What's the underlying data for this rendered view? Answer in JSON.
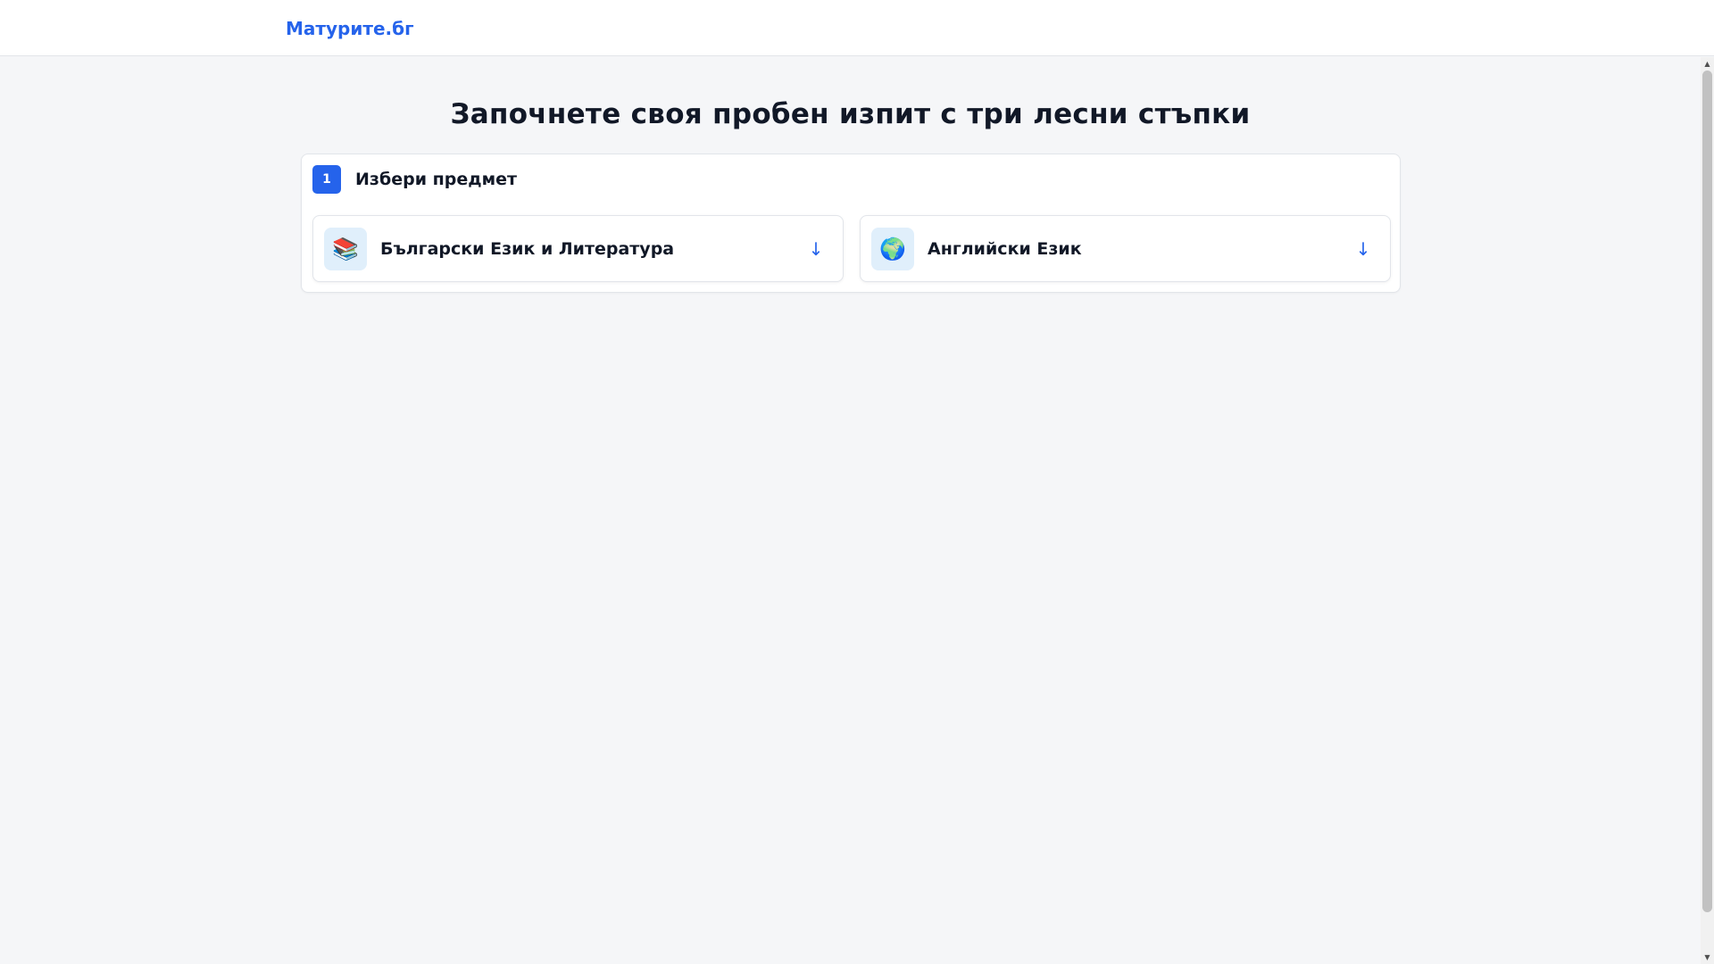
{
  "header": {
    "brand": "Матурите.бг"
  },
  "main": {
    "headline": "Започнете своя пробен изпит с три лесни стъпки",
    "step": {
      "number": "1",
      "title": "Избери предмет",
      "subjects": [
        {
          "label": "Български Език и Литература",
          "icon": "books-icon",
          "glyph": "📚",
          "arrow": "↓"
        },
        {
          "label": "Английски Език",
          "icon": "globe-icon",
          "glyph": "🌍",
          "arrow": "↓"
        }
      ]
    }
  },
  "scrollbar": {
    "up": "▲",
    "down": "▼"
  },
  "colors": {
    "accent": "#2563eb",
    "background": "#f5f6f8",
    "icon_bg": "#e0effb"
  }
}
